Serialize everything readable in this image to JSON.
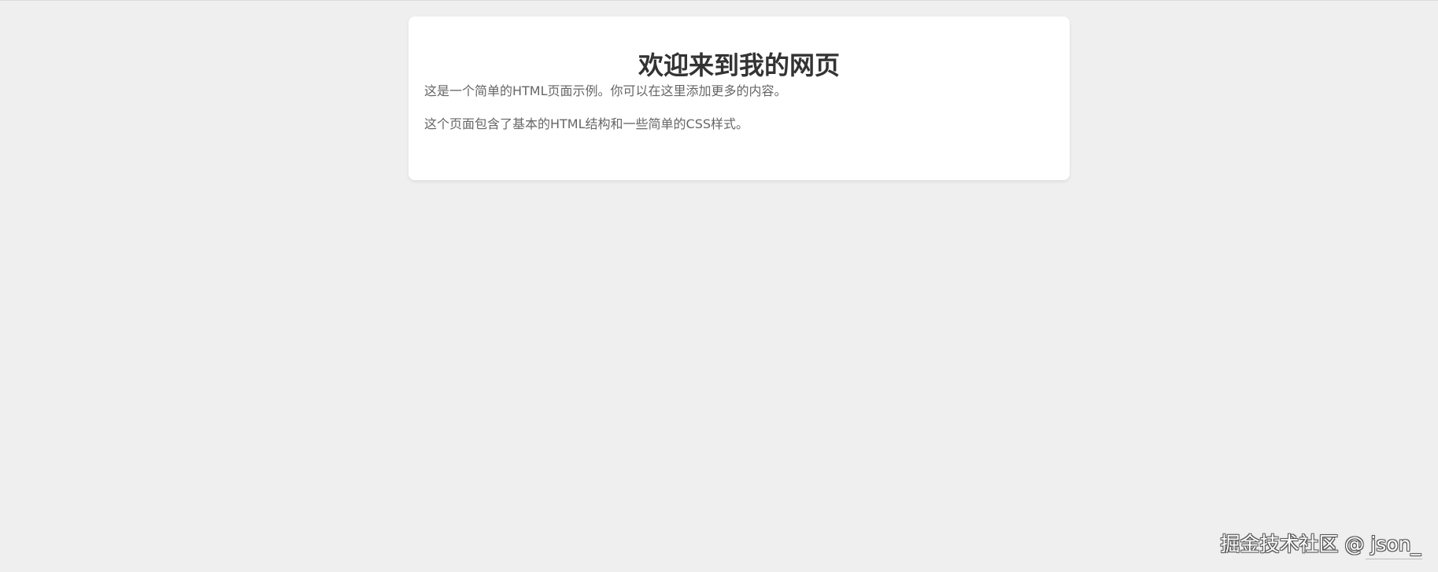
{
  "page": {
    "title": "欢迎来到我的网页",
    "paragraphs": [
      "这是一个简单的HTML页面示例。你可以在这里添加更多的内容。",
      "这个页面包含了基本的HTML结构和一些简单的CSS样式。"
    ]
  },
  "watermark": {
    "text": "掘金技术社区 @ json_"
  },
  "colors": {
    "background": "#efefef",
    "card": "#ffffff",
    "title": "#333333",
    "paragraph": "#666666"
  }
}
